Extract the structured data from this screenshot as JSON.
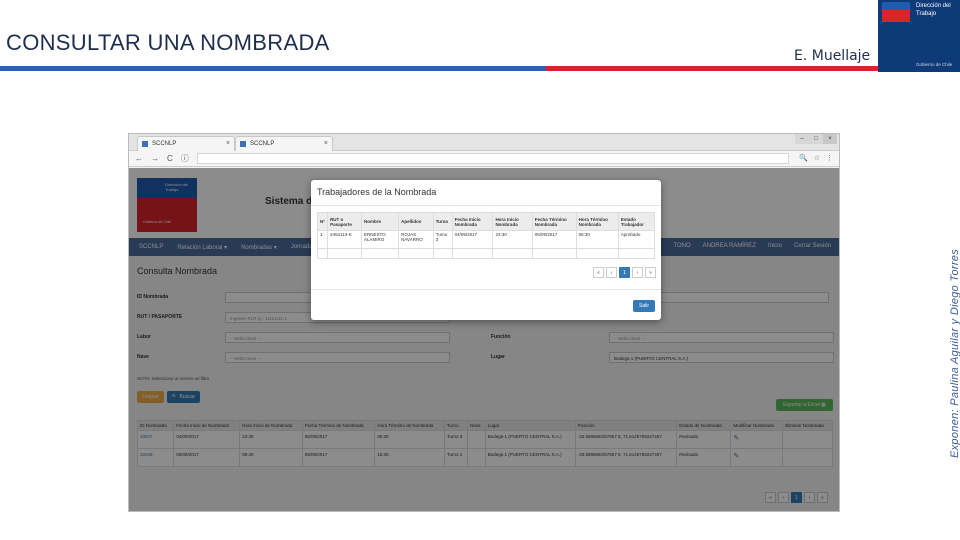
{
  "slide": {
    "title": "CONSULTAR UNA NOMBRADA",
    "author": "E. Muellaje",
    "presenters": "Exponen: Paulina Aguilar y Diego Torres",
    "brand_name": "Dirección del Trabajo",
    "brand_gov": "Gobierno de Chile"
  },
  "browser": {
    "tabs": [
      {
        "label": "SCCNLP",
        "close": "×"
      },
      {
        "label": "SCCNLP",
        "close": "×"
      }
    ],
    "window_controls": [
      "–",
      "□",
      "×"
    ],
    "nav_icons": [
      "←",
      "→",
      "C",
      "ⓘ"
    ]
  },
  "page": {
    "logo_text": "Dirección del Trabajo",
    "logo_subtext": "Gobierno de Chile",
    "system_title": "Sistema de",
    "navbar": {
      "items": [
        "SCCNLP",
        "Relación Laboral ▾",
        "Nombradas ▾",
        "Jornadas"
      ],
      "right": [
        "TONO",
        "ANDREA RAMÍREZ",
        "Inicio",
        "Cerrar Sesión"
      ]
    },
    "heading": "Consulta Nombrada",
    "form": {
      "id_label": "ID Nombrada",
      "rut_label": "RUT / PASAPORTE",
      "rut_placeholder": "Ingrese: RUT ej.: 11111111-1",
      "labor_label": "Labor",
      "labor_value": "-- Seleccione --",
      "nave_label": "Nave",
      "nave_value": "-- Seleccione --",
      "funcion_label": "Función",
      "funcion_value": "-- Seleccione --",
      "lugar_label": "Lugar",
      "lugar_value": "Bodega 1 (PUERTO CENTRAL S.A.)"
    },
    "note": "NOTA: Seleccione al menos un filtro",
    "buttons": {
      "clear": "Limpiar",
      "search": "🔍 Buscar",
      "export": "Exportar a Excel ▦"
    },
    "results": {
      "headers": [
        "ID Nombrada",
        "Fecha Inicio de Nombrada",
        "Hora Inicio de Nombrada",
        "Fecha Término de Nombrada",
        "Hora Término de Nombrada",
        "Turno",
        "Nave",
        "Lugar",
        "Posición",
        "Estado de Nombrada",
        "Modificar Nombrada",
        "Eliminar Nombrada"
      ],
      "rows": [
        [
          "10047",
          "04/09/2017",
          "23:30",
          "05/09/2017",
          "06:30",
          "Turno 3",
          "",
          "Bodega 1 (PUERTO CENTRAL S.A.)",
          "-33.5896682/67857 8, 71.6145759227457",
          "Revisada",
          "✎",
          ""
        ],
        [
          "10048",
          "05/09/2017",
          "08:30",
          "05/09/2017",
          "15:30",
          "Turno 1",
          "",
          "Bodega 1 (PUERTO CENTRAL S.A.)",
          "-33.5896682/67857 8, 71.6145759227457",
          "Revisada",
          "✎",
          ""
        ]
      ]
    },
    "pager": [
      "«",
      "‹",
      "1",
      "›",
      "»"
    ]
  },
  "modal": {
    "title": "Trabajadores de la Nombrada",
    "headers": [
      "N°",
      "RUT o Pasaporte",
      "Nombre",
      "Apellidos",
      "Turno",
      "Fecha Inicio Nombrada",
      "Hora Inicio Nombrada",
      "Fecha Término Nombrada",
      "Hora Término Nombrada",
      "Estado Trabajador"
    ],
    "rows": [
      [
        "1",
        "2454113-K",
        "ERNESTO ALAMIRO",
        "ROJAS NAVARRO",
        "Turno 3",
        "04/09/2017",
        "23:30",
        "05/09/2017",
        "06:30",
        "Aprobado"
      ]
    ],
    "pager": [
      "«",
      "‹",
      "1",
      "›",
      "»"
    ],
    "close_button": "Salir"
  },
  "colors": {
    "stripe_blue": "#2a64b0",
    "stripe_red": "#d8242c",
    "brand_navy": "#0e3a78",
    "primary": "#337ab7"
  }
}
